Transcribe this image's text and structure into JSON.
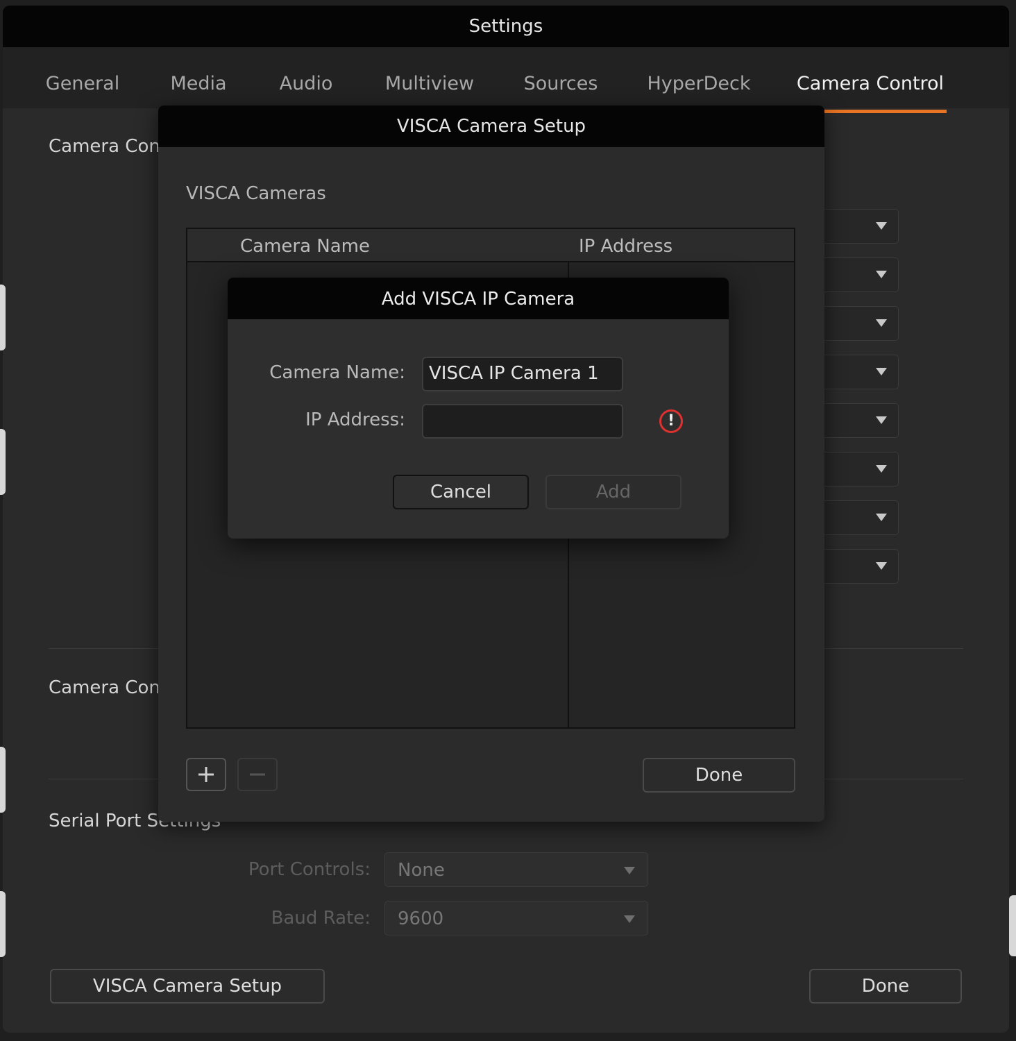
{
  "window": {
    "title": "Settings"
  },
  "tabs": [
    {
      "label": "General"
    },
    {
      "label": "Media"
    },
    {
      "label": "Audio"
    },
    {
      "label": "Multiview"
    },
    {
      "label": "Sources"
    },
    {
      "label": "HyperDeck"
    },
    {
      "label": "Camera Control",
      "active": true
    }
  ],
  "accent_color": "#e87424",
  "main": {
    "section1_title": "Camera Cont",
    "section2_title": "Camera Cont",
    "serial_title": "Serial Port Settings",
    "port_controls_label": "Port Controls:",
    "port_controls_value": "None",
    "baud_rate_label": "Baud Rate:",
    "baud_rate_value": "9600",
    "visca_setup_button": "VISCA Camera Setup",
    "done_button": "Done"
  },
  "visca_dialog": {
    "title": "VISCA Camera Setup",
    "list_label": "VISCA Cameras",
    "columns": [
      "Camera Name",
      "IP Address"
    ],
    "rows": [],
    "add_icon": "plus-icon",
    "remove_icon": "minus-icon",
    "done_button": "Done"
  },
  "add_dialog": {
    "title": "Add VISCA IP Camera",
    "camera_name_label": "Camera Name:",
    "camera_name_value": "VISCA IP Camera 1",
    "ip_address_label": "IP Address:",
    "ip_address_value": "",
    "warning_icon": "warning-icon",
    "warning_color": "#e03131",
    "cancel_button": "Cancel",
    "add_button": "Add"
  }
}
